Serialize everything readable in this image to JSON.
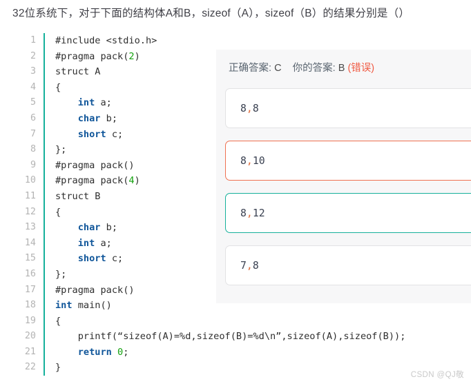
{
  "question": {
    "title": "32位系统下，对于下面的结构体A和B，sizeof（A），sizeof（B）的结果分别是（）"
  },
  "code": {
    "language": "c",
    "lines": [
      {
        "n": "1",
        "tokens": [
          {
            "t": "#include <stdio.h>",
            "c": "plain"
          }
        ]
      },
      {
        "n": "2",
        "tokens": [
          {
            "t": "#pragma pack(",
            "c": "plain"
          },
          {
            "t": "2",
            "c": "num"
          },
          {
            "t": ")",
            "c": "plain"
          }
        ]
      },
      {
        "n": "3",
        "tokens": [
          {
            "t": "struct A",
            "c": "plain"
          }
        ]
      },
      {
        "n": "4",
        "tokens": [
          {
            "t": "{",
            "c": "plain"
          }
        ]
      },
      {
        "n": "5",
        "tokens": [
          {
            "t": "    ",
            "c": "plain"
          },
          {
            "t": "int",
            "c": "kw"
          },
          {
            "t": " a;",
            "c": "plain"
          }
        ]
      },
      {
        "n": "6",
        "tokens": [
          {
            "t": "    ",
            "c": "plain"
          },
          {
            "t": "char",
            "c": "kw"
          },
          {
            "t": " b;",
            "c": "plain"
          }
        ]
      },
      {
        "n": "7",
        "tokens": [
          {
            "t": "    ",
            "c": "plain"
          },
          {
            "t": "short",
            "c": "kw"
          },
          {
            "t": " c;",
            "c": "plain"
          }
        ]
      },
      {
        "n": "8",
        "tokens": [
          {
            "t": "};",
            "c": "plain"
          }
        ]
      },
      {
        "n": "9",
        "tokens": [
          {
            "t": "#pragma pack()",
            "c": "plain"
          }
        ]
      },
      {
        "n": "10",
        "tokens": [
          {
            "t": "#pragma pack(",
            "c": "plain"
          },
          {
            "t": "4",
            "c": "num"
          },
          {
            "t": ")",
            "c": "plain"
          }
        ]
      },
      {
        "n": "11",
        "tokens": [
          {
            "t": "struct B",
            "c": "plain"
          }
        ]
      },
      {
        "n": "12",
        "tokens": [
          {
            "t": "{",
            "c": "plain"
          }
        ]
      },
      {
        "n": "13",
        "tokens": [
          {
            "t": "    ",
            "c": "plain"
          },
          {
            "t": "char",
            "c": "kw"
          },
          {
            "t": " b;",
            "c": "plain"
          }
        ]
      },
      {
        "n": "14",
        "tokens": [
          {
            "t": "    ",
            "c": "plain"
          },
          {
            "t": "int",
            "c": "kw"
          },
          {
            "t": " a;",
            "c": "plain"
          }
        ]
      },
      {
        "n": "15",
        "tokens": [
          {
            "t": "    ",
            "c": "plain"
          },
          {
            "t": "short",
            "c": "kw"
          },
          {
            "t": " c;",
            "c": "plain"
          }
        ]
      },
      {
        "n": "16",
        "tokens": [
          {
            "t": "};",
            "c": "plain"
          }
        ]
      },
      {
        "n": "17",
        "tokens": [
          {
            "t": "#pragma pack()",
            "c": "plain"
          }
        ]
      },
      {
        "n": "18",
        "tokens": [
          {
            "t": "int",
            "c": "kw"
          },
          {
            "t": " main()",
            "c": "plain"
          }
        ]
      },
      {
        "n": "19",
        "tokens": [
          {
            "t": "{",
            "c": "plain"
          }
        ]
      },
      {
        "n": "20",
        "tokens": [
          {
            "t": "    printf(“sizeof(A)=%d,sizeof(B)=%d\\n”,sizeof(A),sizeof(B));",
            "c": "plain"
          }
        ]
      },
      {
        "n": "21",
        "tokens": [
          {
            "t": "    ",
            "c": "plain"
          },
          {
            "t": "return",
            "c": "kw"
          },
          {
            "t": " ",
            "c": "plain"
          },
          {
            "t": "0",
            "c": "num"
          },
          {
            "t": ";",
            "c": "plain"
          }
        ]
      },
      {
        "n": "22",
        "tokens": [
          {
            "t": "}",
            "c": "plain"
          }
        ]
      }
    ]
  },
  "answer_panel": {
    "correct_label": "正确答案:",
    "correct_value": "C",
    "your_label": "你的答案:",
    "your_value": "B",
    "wrong_mark": "(错误)",
    "options": [
      {
        "key": "A",
        "left": "8",
        "sep": ",",
        "right": "8",
        "state": "none"
      },
      {
        "key": "B",
        "left": "8",
        "sep": ",",
        "right": "10",
        "state": "wrong"
      },
      {
        "key": "C",
        "left": "8",
        "sep": ",",
        "right": "12",
        "state": "correct"
      },
      {
        "key": "D",
        "left": "7",
        "sep": ",",
        "right": "8",
        "state": "none"
      }
    ]
  },
  "watermark": {
    "text": "CSDN @QJ敬"
  },
  "colors": {
    "keyword": "#10569a",
    "number": "#13a10e",
    "gutter_bar": "#14b09a",
    "correct_border": "#14b09a",
    "wrong_border": "#ef7050",
    "wrong_text": "#f05b44",
    "panel_bg": "#f7f7f8"
  }
}
